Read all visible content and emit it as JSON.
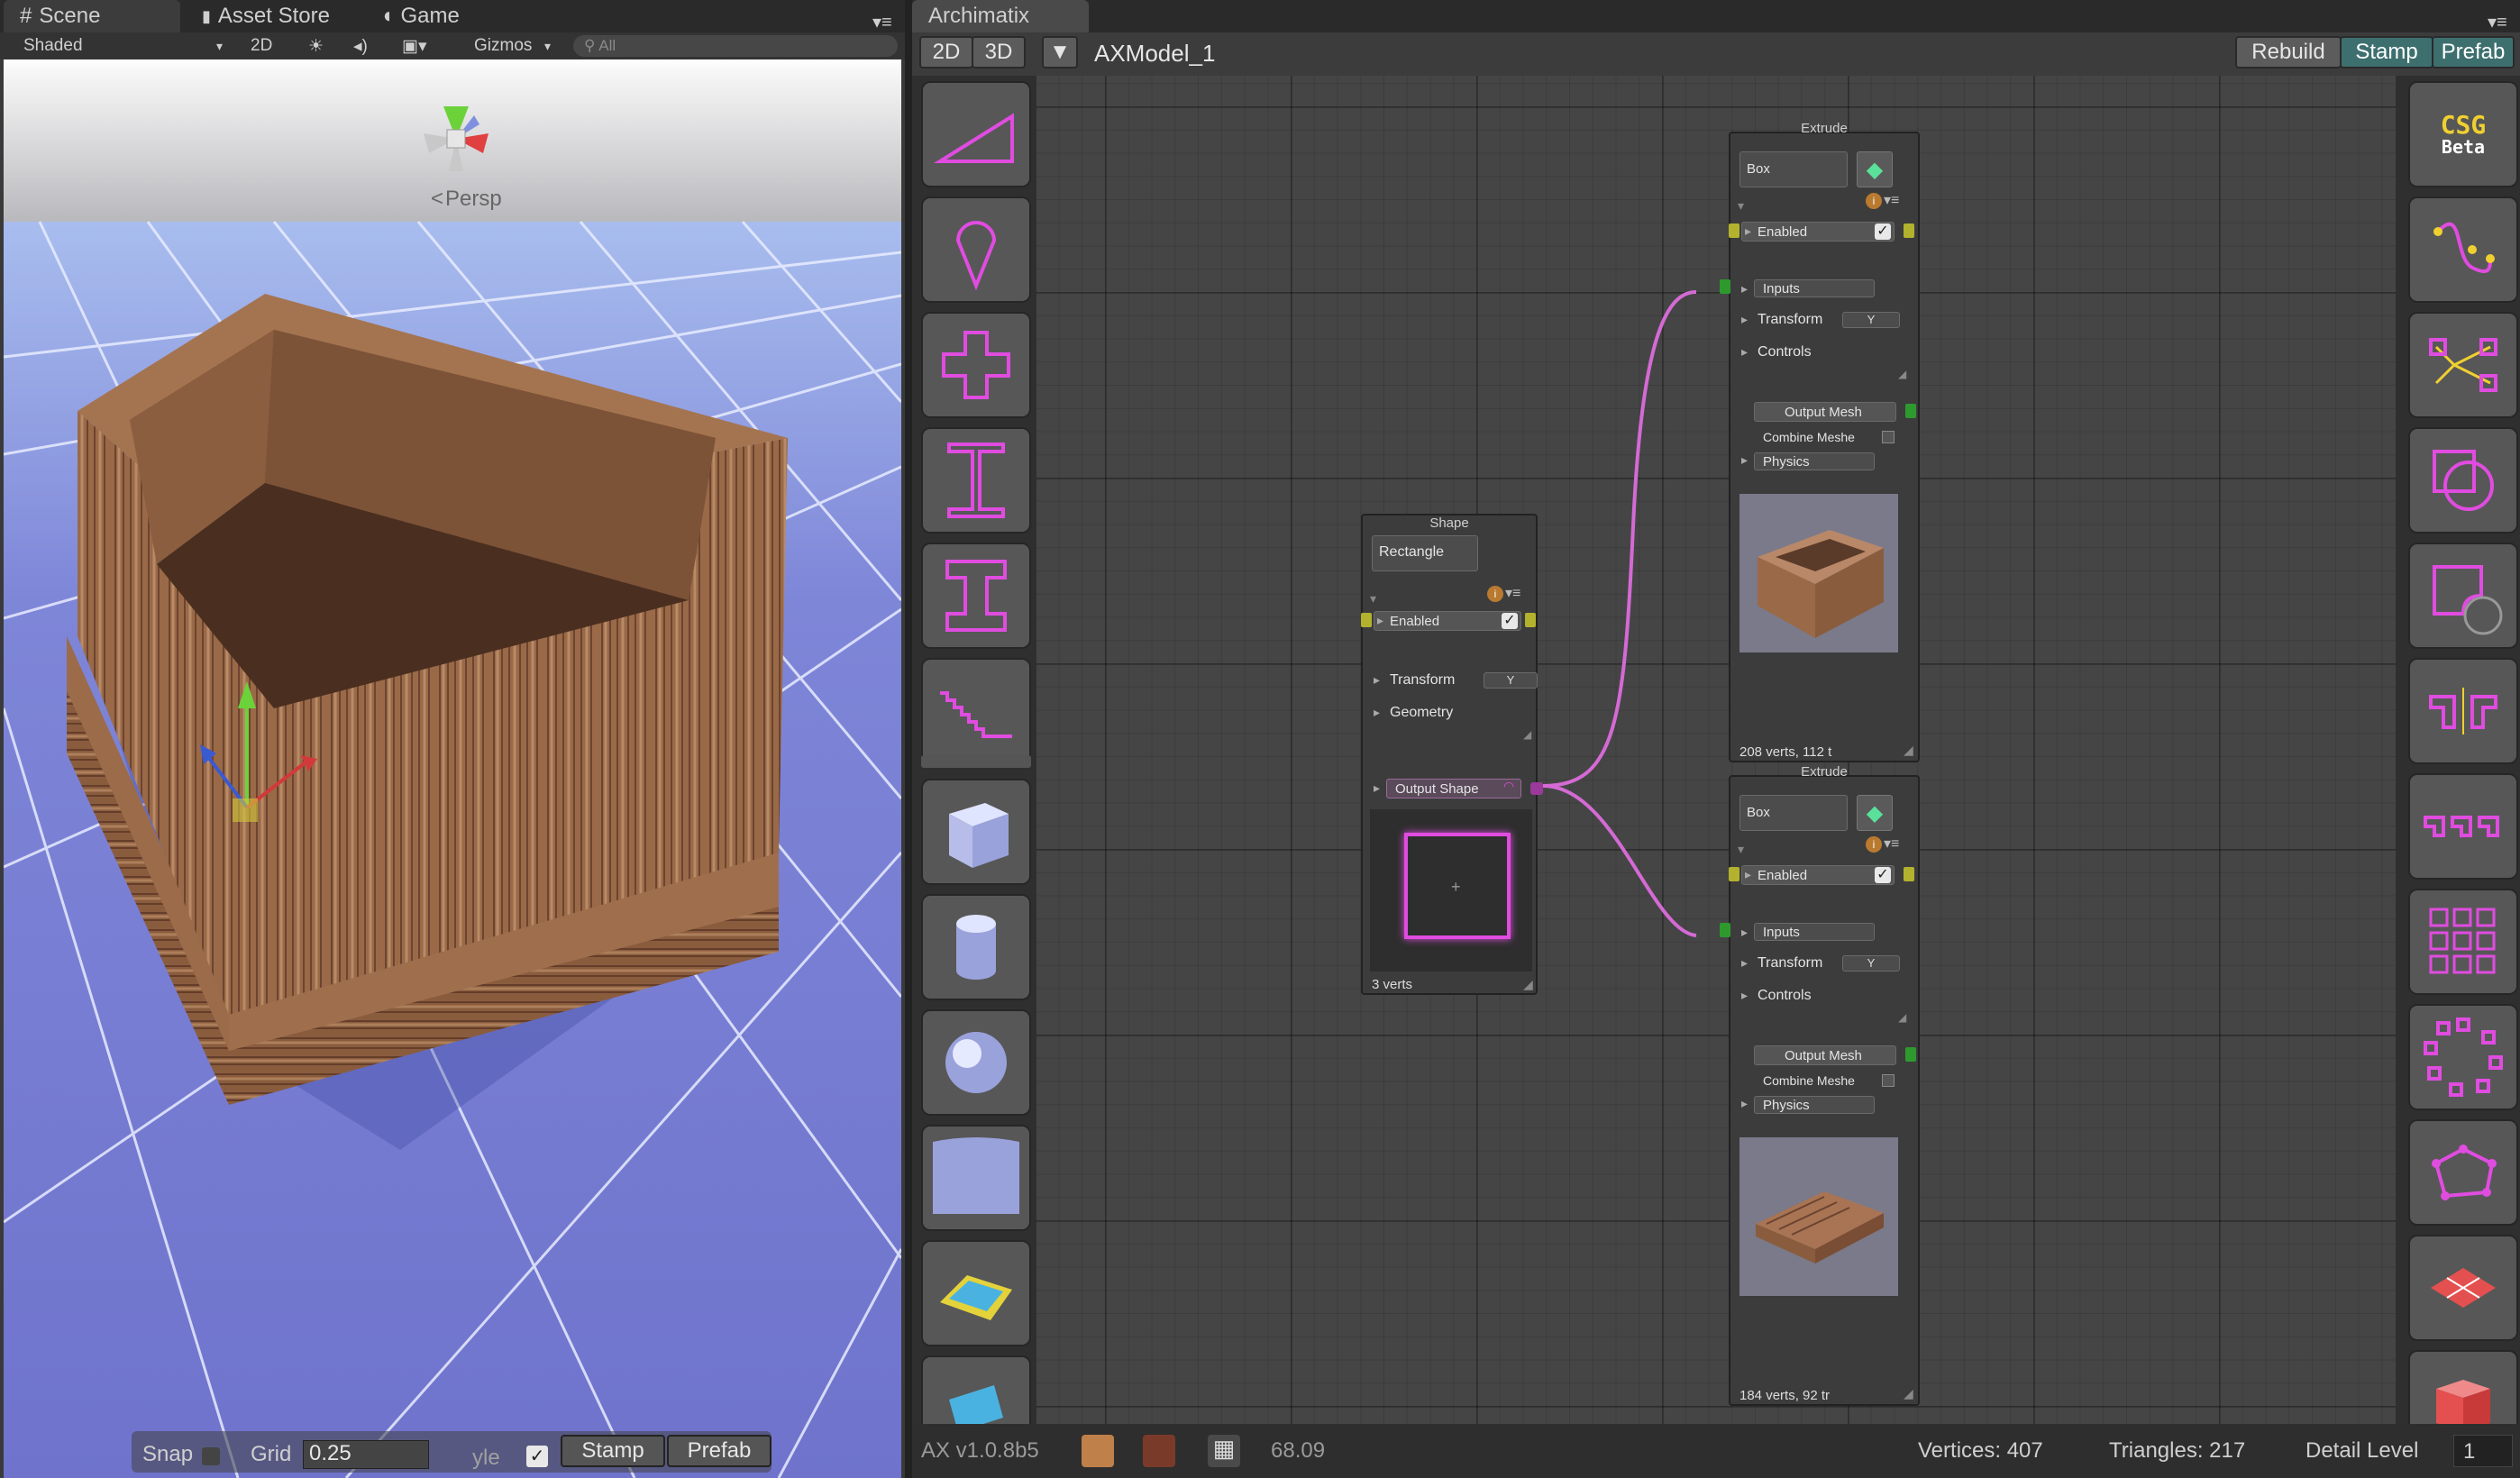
{
  "scene_tabs": [
    {
      "label": "Scene"
    },
    {
      "label": "Asset Store"
    },
    {
      "label": "Game"
    }
  ],
  "scene_toolbar": {
    "shading": "Shaded",
    "mode_2d": "2D",
    "gizmos": "Gizmos",
    "search_placeholder": "All"
  },
  "viewport": {
    "projection": "Persp"
  },
  "scene_bottom": {
    "snap_label": "Snap",
    "grid_label": "Grid",
    "grid_value": "0.25",
    "style_label": "yle",
    "stamp_label": "Stamp",
    "prefab_label": "Prefab"
  },
  "ax_tab": {
    "label": "Archimatix"
  },
  "ax_header": {
    "view_2d": "2D",
    "view_3d": "3D",
    "model_name": "AXModel_1",
    "rebuild": "Rebuild",
    "stamp": "Stamp",
    "prefab": "Prefab"
  },
  "shape_node": {
    "title": "Shape",
    "type": "Rectangle",
    "enabled": "Enabled",
    "transform": "Transform",
    "transform_axis": "Y",
    "geometry": "Geometry",
    "output": "Output Shape",
    "stats": "3 verts"
  },
  "extrude_nodes": [
    {
      "title": "Extrude",
      "type": "Box",
      "enabled": "Enabled",
      "inputs": "Inputs",
      "transform": "Transform",
      "transform_axis": "Y",
      "controls": "Controls",
      "output_mesh": "Output Mesh",
      "combine": "Combine Meshe",
      "physics": "Physics",
      "stats": "208 verts, 112 t"
    },
    {
      "title": "Extrude",
      "type": "Box",
      "enabled": "Enabled",
      "inputs": "Inputs",
      "transform": "Transform",
      "transform_axis": "Y",
      "controls": "Controls",
      "output_mesh": "Output Mesh",
      "combine": "Combine Meshe",
      "physics": "Physics",
      "stats": "184 verts, 92 tr"
    }
  ],
  "right_palette": {
    "csg_title": "CSG",
    "csg_sub": "Beta"
  },
  "status": {
    "version": "AX v1.0.8b5",
    "fps": "68.09",
    "vertices": "Vertices: 407",
    "triangles": "Triangles: 217",
    "detail_label": "Detail Level",
    "detail_value": "1"
  },
  "icons": [
    "scene-grid-icon",
    "lock-icon",
    "game-icon",
    "sun-icon",
    "audio-icon",
    "image-icon",
    "search-icon",
    "orientation-gizmo-icon",
    "triangle-shape-icon",
    "teardrop-shape-icon",
    "cross-shape-icon",
    "i-beam-icon",
    "i-section-icon",
    "stair-icon",
    "cube-icon",
    "cylinder-icon",
    "sphere-icon",
    "plane-icon",
    "rounded-box-icon",
    "book-icon",
    "curve-icon",
    "branch-icon",
    "offset-icon",
    "fillet-icon",
    "mirror-icon",
    "linear-repeater-icon",
    "grid-repeater-icon",
    "radial-repeater-icon",
    "path-repeater-icon",
    "floor-tile-icon",
    "box-red-icon"
  ],
  "colors": {
    "accent_magenta": "#e04ce0",
    "teal_button": "#3d6f6f",
    "port_yellow": "#b2b22e",
    "port_green": "#2e9a2e"
  }
}
